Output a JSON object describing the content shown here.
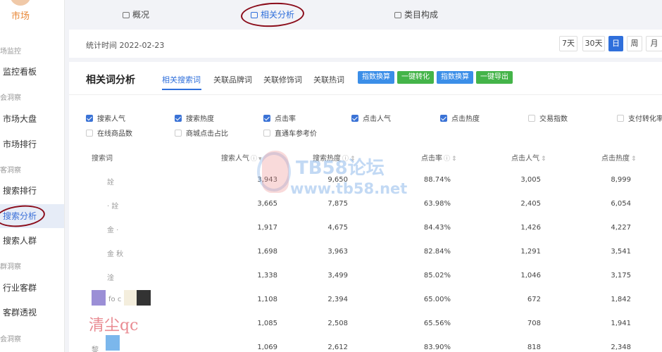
{
  "sidebar": {
    "brand": "市场",
    "groups": [
      "场监控",
      "会洞察",
      "客洞察",
      "群洞察",
      "会洞察"
    ],
    "items": [
      "监控看板",
      "市场大盘",
      "市场排行",
      "搜索排行",
      "搜索分析",
      "搜索人群",
      "行业客群",
      "客群透视"
    ]
  },
  "tabs": [
    "概况",
    "相关分析",
    "类目构成"
  ],
  "stats": {
    "date_label": "统计时间 2022-02-23",
    "periods": [
      "7天",
      "30天",
      "日",
      "周",
      "月"
    ]
  },
  "panel": {
    "title": "相关词分析",
    "subtabs": [
      "相关搜索词",
      "关联品牌词",
      "关联修饰词",
      "关联热词"
    ],
    "actions": [
      "指数换算",
      "一键转化",
      "指数换算",
      "一键导出"
    ],
    "action_colors": [
      "#3b8ee8",
      "#44b449",
      "#3b8ee8",
      "#44b449"
    ]
  },
  "metrics": [
    {
      "label": "搜索人气",
      "checked": true
    },
    {
      "label": "搜索热度",
      "checked": true
    },
    {
      "label": "点击率",
      "checked": true
    },
    {
      "label": "点击人气",
      "checked": true
    },
    {
      "label": "点击热度",
      "checked": true
    },
    {
      "label": "交易指数",
      "checked": false
    },
    {
      "label": "支付转化率",
      "checked": false
    },
    {
      "label": "在线商品数",
      "checked": false
    },
    {
      "label": "商城点击占比",
      "checked": false
    },
    {
      "label": "直通车参考价",
      "checked": false
    }
  ],
  "table": {
    "headers": [
      "搜索词",
      "搜索人气",
      "搜索热度",
      "点击率",
      "点击人气",
      "点击热度"
    ],
    "rows": [
      {
        "kw": "詮",
        "c1": "3,943",
        "c2": "9,650",
        "c3": "88.74%",
        "c4": "3,005",
        "c5": "8,999"
      },
      {
        "kw": "·     詮",
        "c1": "3,665",
        "c2": "7,875",
        "c3": "63.98%",
        "c4": "2,405",
        "c5": "6,054"
      },
      {
        "kw": "金  ·",
        "c1": "1,917",
        "c2": "4,675",
        "c3": "84.43%",
        "c4": "1,426",
        "c5": "4,227"
      },
      {
        "kw": "金   秋",
        "c1": "1,698",
        "c2": "3,963",
        "c3": "82.84%",
        "c4": "1,291",
        "c5": "3,541"
      },
      {
        "kw": "淦",
        "c1": "1,338",
        "c2": "3,499",
        "c3": "85.02%",
        "c4": "1,046",
        "c5": "3,175"
      },
      {
        "kw": "fo      c",
        "c1": "1,108",
        "c2": "2,394",
        "c3": "65.00%",
        "c4": "672",
        "c5": "1,842"
      },
      {
        "kw": "",
        "c1": "1,085",
        "c2": "2,508",
        "c3": "65.56%",
        "c4": "708",
        "c5": "1,941"
      },
      {
        "kw": "黎",
        "c1": "1,069",
        "c2": "2,612",
        "c3": "83.90%",
        "c4": "818",
        "c5": "2,348"
      }
    ]
  },
  "watermark": {
    "line1": "TB58论坛",
    "line2": "www.tb58.net",
    "signature": "清尘qc"
  }
}
